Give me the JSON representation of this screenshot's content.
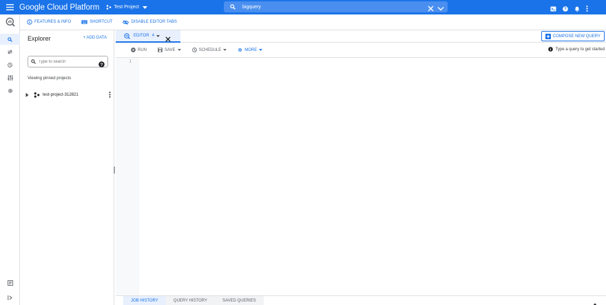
{
  "topbar": {
    "brand": "Google Cloud Platform",
    "project": "Test Project",
    "search_value": "bigquery",
    "bg_color": "#1a73e8"
  },
  "subbar": {
    "features": "FEATURES & INFO",
    "shortcut": "SHORTCUT",
    "disable_tabs": "DISABLE EDITOR TABS"
  },
  "explorer": {
    "title": "Explorer",
    "add_data": "+ ADD DATA",
    "search_placeholder": "Type to search",
    "pinned_label": "Viewing pinned projects",
    "project_name": "test-project-312821"
  },
  "editor": {
    "tab_label": "EDITOR",
    "tab_count": "4",
    "compose": "COMPOSE NEW QUERY",
    "run": "RUN",
    "save": "SAVE",
    "schedule": "SCHEDULE",
    "more": "MORE",
    "hint": "Type a query to get started",
    "line_number": "1"
  },
  "bottom": {
    "tabs": [
      "JOB HISTORY",
      "QUERY HISTORY",
      "SAVED QUERIES"
    ]
  }
}
